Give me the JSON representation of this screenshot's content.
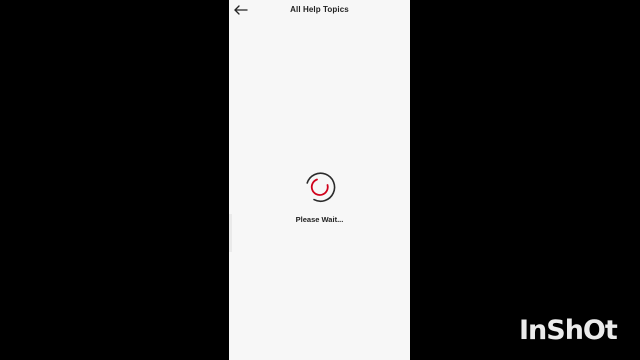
{
  "header": {
    "title": "All Help Topics",
    "back_icon": "arrow-left-icon"
  },
  "loading": {
    "spinner_icon": "loading-spinner-icon",
    "message": "Please Wait..."
  },
  "colors": {
    "background": "#000000",
    "screen": "#f7f7f7",
    "spinner_primary": "#d0021b",
    "spinner_secondary": "#2b2b2b",
    "text": "#222222"
  },
  "watermark": {
    "text": "InShOt"
  }
}
